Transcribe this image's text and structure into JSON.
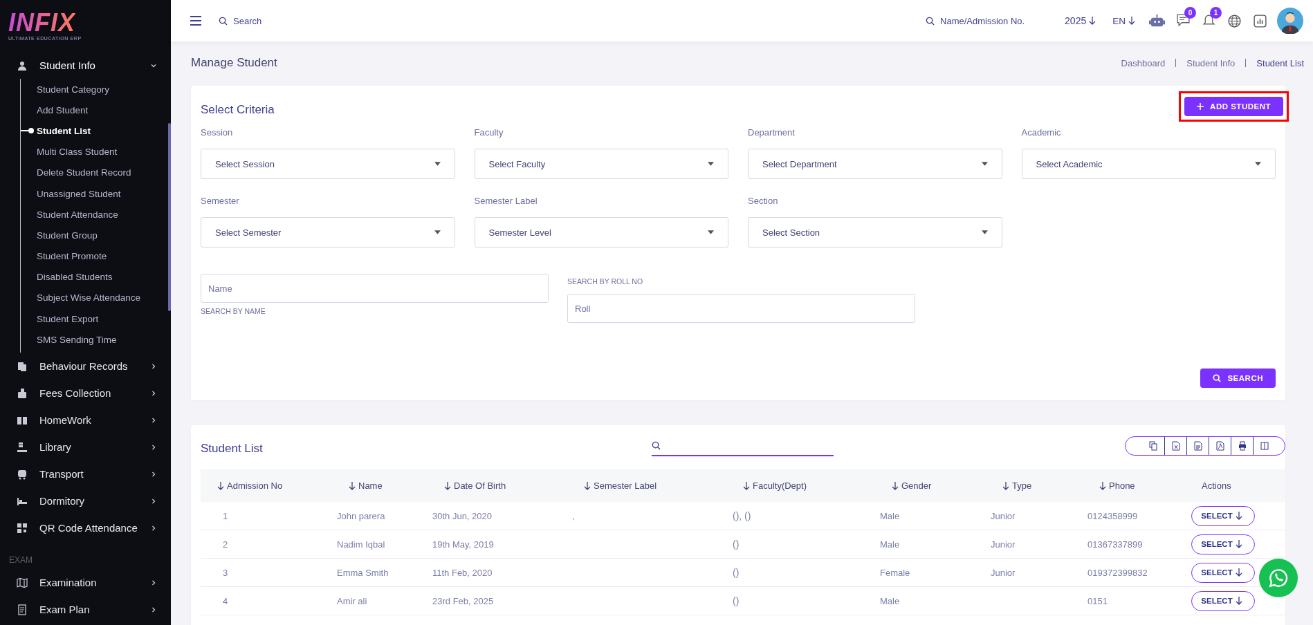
{
  "sidebar": {
    "logo": "INFIX",
    "tagline": "ULTIMATE EDUCATION ERP",
    "items": [
      {
        "label": "Student Info",
        "expanded": true,
        "children": [
          {
            "label": "Student Category",
            "selected": false
          },
          {
            "label": "Add Student",
            "selected": false
          },
          {
            "label": "Student List",
            "selected": true
          },
          {
            "label": "Multi Class Student",
            "selected": false
          },
          {
            "label": "Delete Student Record",
            "selected": false
          },
          {
            "label": "Unassigned Student",
            "selected": false
          },
          {
            "label": "Student Attendance",
            "selected": false
          },
          {
            "label": "Student Group",
            "selected": false
          },
          {
            "label": "Student Promote",
            "selected": false
          },
          {
            "label": "Disabled Students",
            "selected": false
          },
          {
            "label": "Subject Wise Attendance",
            "selected": false
          },
          {
            "label": "Student Export",
            "selected": false
          },
          {
            "label": "SMS Sending Time",
            "selected": false
          }
        ]
      },
      {
        "label": "Behaviour Records",
        "expanded": false
      },
      {
        "label": "Fees Collection",
        "expanded": false
      },
      {
        "label": "HomeWork",
        "expanded": false
      },
      {
        "label": "Library",
        "expanded": false
      },
      {
        "label": "Transport",
        "expanded": false
      },
      {
        "label": "Dormitory",
        "expanded": false
      },
      {
        "label": "QR Code Attendance",
        "expanded": false
      }
    ],
    "section": "EXAM",
    "exam_items": [
      {
        "label": "Examination",
        "expanded": false
      },
      {
        "label": "Exam Plan",
        "expanded": false
      }
    ]
  },
  "topbar": {
    "search": {
      "placeholder": "Search"
    },
    "quick_search": {
      "placeholder": "Name/Admission No."
    },
    "year": "2025",
    "language": "EN",
    "messages_badge": "0",
    "notifications_badge": "1"
  },
  "page": {
    "title": "Manage Student",
    "breadcrumb": [
      {
        "label": "Dashboard",
        "current": false
      },
      {
        "label": "Student Info",
        "current": false
      },
      {
        "label": "Student List",
        "current": true
      }
    ]
  },
  "criteria": {
    "title": "Select Criteria",
    "add_button": {
      "label": "ADD STUDENT",
      "highlighted": true
    },
    "selects": [
      {
        "label": "Session",
        "placeholder": "Select Session"
      },
      {
        "label": "Faculty",
        "placeholder": "Select Faculty"
      },
      {
        "label": "Department",
        "placeholder": "Select Department"
      },
      {
        "label": "Academic",
        "placeholder": "Select Academic"
      },
      {
        "label": "Semester",
        "placeholder": "Select Semester"
      },
      {
        "label": "Semester Label",
        "placeholder": "Semester Level"
      },
      {
        "label": "Section",
        "placeholder": "Select Section"
      }
    ],
    "name_field": {
      "placeholder": "Name",
      "caption": "SEARCH BY NAME"
    },
    "roll_field": {
      "label": "SEARCH BY ROLL NO",
      "placeholder": "Roll"
    },
    "search_button": "SEARCH"
  },
  "student_list": {
    "title": "Student List",
    "columns": [
      {
        "label": "Admission No",
        "sortable": true
      },
      {
        "label": "Name",
        "sortable": true
      },
      {
        "label": "Date Of Birth",
        "sortable": true
      },
      {
        "label": "Semester Label",
        "sortable": true
      },
      {
        "label": "Faculty(Dept)",
        "sortable": true
      },
      {
        "label": "Gender",
        "sortable": true
      },
      {
        "label": "Type",
        "sortable": true
      },
      {
        "label": "Phone",
        "sortable": true
      },
      {
        "label": "Actions",
        "sortable": false
      }
    ],
    "rows": [
      {
        "cells": [
          "1",
          "John parera",
          "30th Jun, 2020",
          ",",
          "(), ()",
          "Male",
          "Junior",
          "0124358999"
        ],
        "action": "SELECT"
      },
      {
        "cells": [
          "2",
          "Nadim Iqbal",
          "19th May, 2019",
          "",
          "()",
          "Male",
          "Junior",
          "01367337899"
        ],
        "action": "SELECT"
      },
      {
        "cells": [
          "3",
          "Emma Smith",
          "11th Feb, 2020",
          "",
          "()",
          "Female",
          "Junior",
          "019372399832"
        ],
        "action": "SELECT"
      },
      {
        "cells": [
          "4",
          "Amir ali",
          "23rd Feb, 2025",
          "",
          "()",
          "Male",
          "",
          "0151"
        ],
        "action": "SELECT"
      }
    ]
  }
}
